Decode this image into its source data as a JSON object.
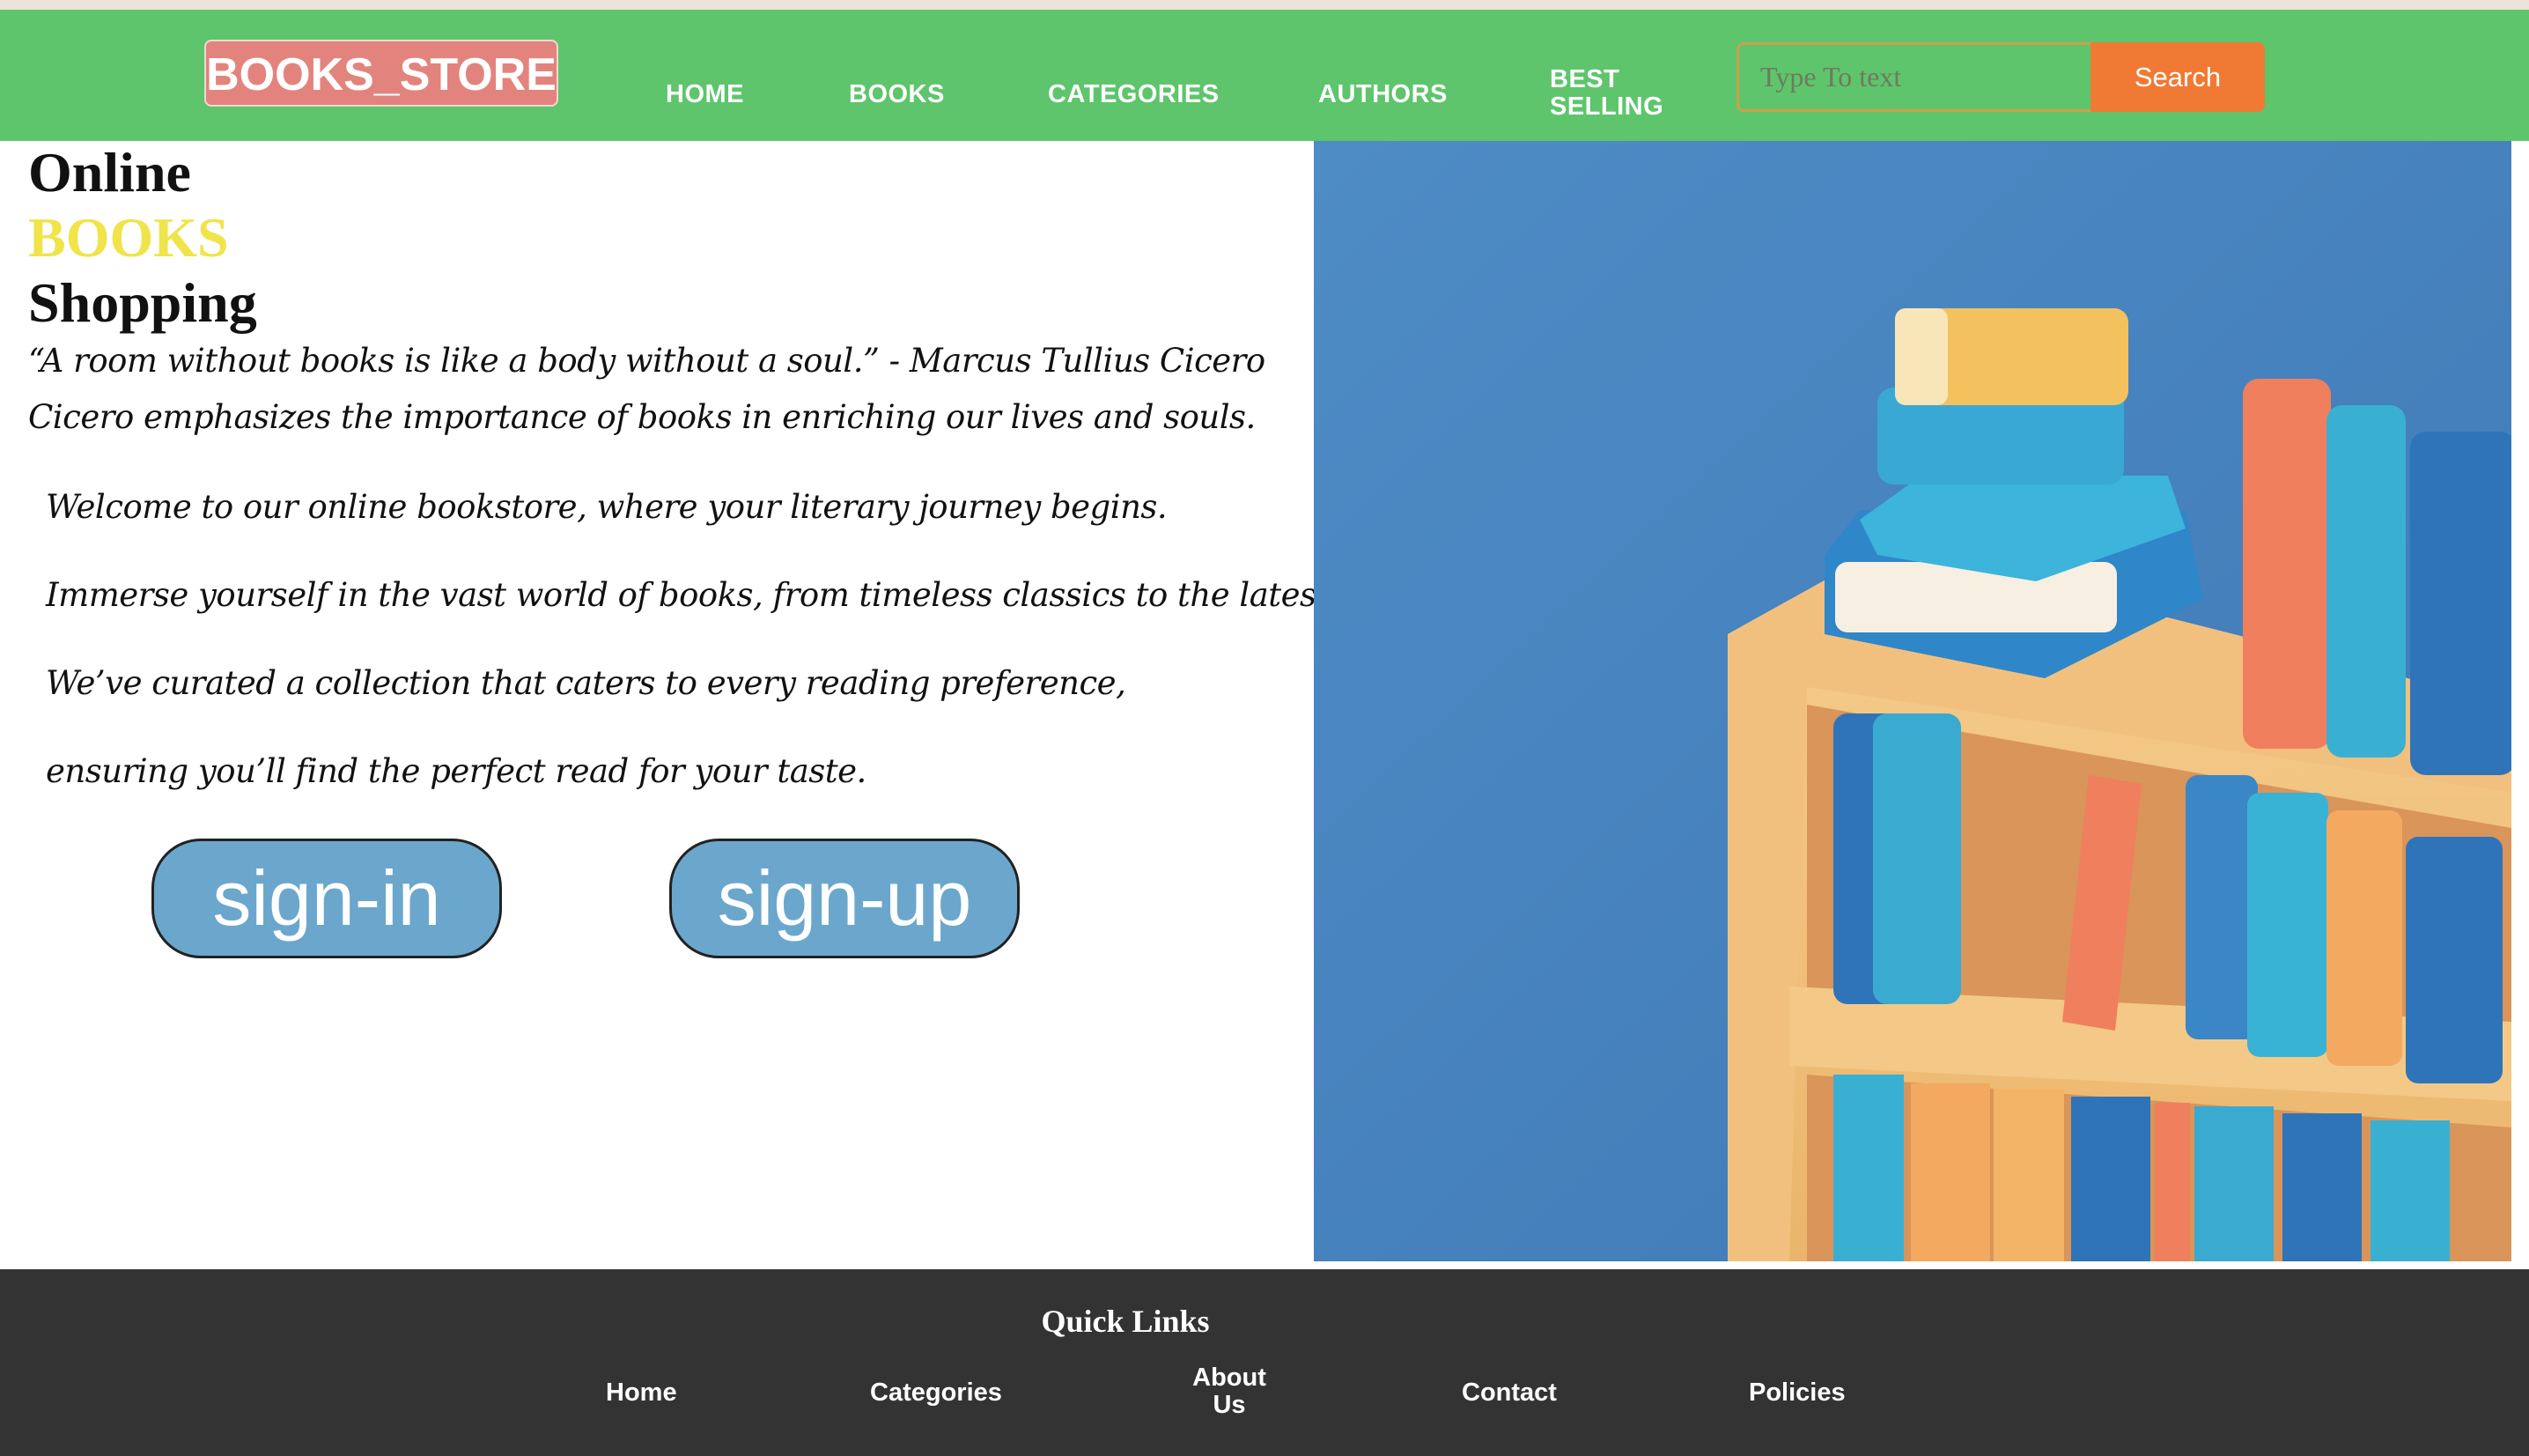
{
  "header": {
    "logo": "BOOKS_STORE",
    "nav": {
      "home": "HOME",
      "books": "BOOKS",
      "categories": "CATEGORIES",
      "authors": "AUTHORS",
      "best_selling": "BEST SELLING"
    },
    "search": {
      "placeholder": "Type To text",
      "button": "Search"
    }
  },
  "hero": {
    "title_line1": "Online",
    "title_line2": "BOOKS",
    "title_line3": "Shopping",
    "quote": "“A room without books is like a body without a soul.” - Marcus Tullius Cicero",
    "quote_note": "Cicero emphasizes the importance of books in enriching our lives and souls.",
    "paragraphs": [
      "Welcome to our online bookstore, where your literary journey begins.",
      "Immerse yourself in the vast world of books, from timeless classics to the latest bestsellers.",
      "We’ve curated a collection that caters to every reading preference,",
      "ensuring you’ll find the perfect read for your taste."
    ],
    "signin": "sign-in",
    "signup": "sign-up"
  },
  "footer": {
    "title": "Quick Links",
    "links": {
      "home": "Home",
      "categories": "Categories",
      "about": "About Us",
      "contact": "Contact",
      "policies": "Policies"
    }
  },
  "colors": {
    "navbar": "#5ec56c",
    "logo_bg": "#e2847d",
    "search_button": "#f07a34",
    "accent_yellow": "#f0e44b",
    "pill_button": "#6ba7cc",
    "footer_bg": "#333333",
    "image_wall": "#4a88c2"
  }
}
